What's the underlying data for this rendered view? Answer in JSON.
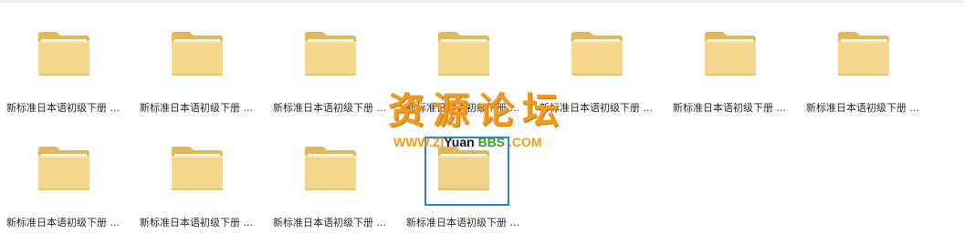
{
  "files": [
    {
      "name": "新标准日本语初级下册 ..."
    },
    {
      "name": "新标准日本语初级下册 ..."
    },
    {
      "name": "新标准日本语初级下册 ..."
    },
    {
      "name": "新标准日本语初级下册 ..."
    },
    {
      "name": "新标准日本语初级下册 ..."
    },
    {
      "name": "新标准日本语初级下册 ..."
    },
    {
      "name": "新标准日本语初级下册 ..."
    },
    {
      "name": "新标准日本语初级下册 ..."
    },
    {
      "name": "新标准日本语初级下册 ..."
    },
    {
      "name": "新标准日本语初级下册 ..."
    },
    {
      "name": "新标准日本语初级下册 ..."
    }
  ],
  "watermark": {
    "text": "资源论坛",
    "url_prefix": "WWW.",
    "url_zi": "ZI",
    "url_yuan": "Yuan",
    "url_bbs": "BBS",
    "url_suffix": ".COM"
  },
  "colors": {
    "folder_back": "#e9c46a",
    "folder_front": "#f7d584",
    "selection": "#2f7fd6",
    "watermark_orange": "#f29a1b",
    "watermark_green": "#40a01c"
  },
  "icons": {
    "file_item": "folder-icon"
  }
}
